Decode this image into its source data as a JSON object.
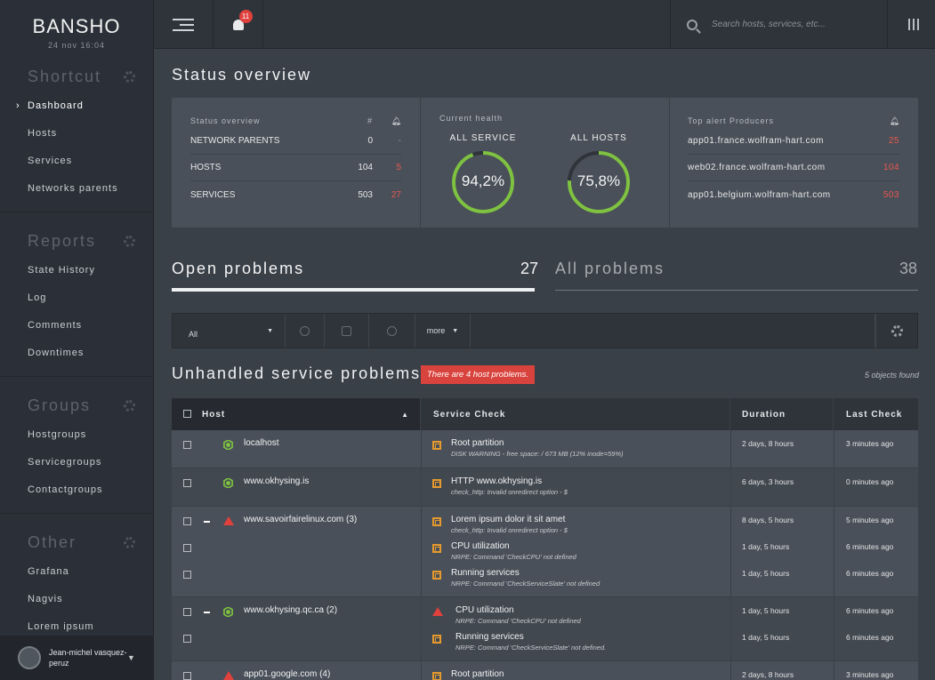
{
  "brand": {
    "name": "BANSHO",
    "date": "24 nov 16:04"
  },
  "sidebar": {
    "sections": [
      {
        "title": "Shortcut",
        "items": [
          {
            "label": "Dashboard",
            "active": true
          },
          {
            "label": "Hosts"
          },
          {
            "label": "Services"
          },
          {
            "label": "Networks parents"
          }
        ]
      },
      {
        "title": "Reports",
        "items": [
          {
            "label": "State History"
          },
          {
            "label": "Log"
          },
          {
            "label": "Comments"
          },
          {
            "label": "Downtimes"
          }
        ]
      },
      {
        "title": "Groups",
        "items": [
          {
            "label": "Hostgroups"
          },
          {
            "label": "Servicegroups"
          },
          {
            "label": "Contactgroups"
          }
        ]
      },
      {
        "title": "Other",
        "items": [
          {
            "label": "Grafana"
          },
          {
            "label": "Nagvis"
          },
          {
            "label": "Lorem ipsum"
          }
        ]
      }
    ],
    "user": {
      "name": "Jean-michel vasquez-peruz"
    }
  },
  "topbar": {
    "notifications": "11",
    "search_placeholder": "Search hosts, services, etc..."
  },
  "page_title": "Status overview",
  "overview": {
    "status": {
      "header": "Status overview",
      "col_count": "#",
      "rows": [
        {
          "label": "NETWORK PARENTS",
          "count": "0",
          "alerts": "-"
        },
        {
          "label": "HOSTS",
          "count": "104",
          "alerts": "5"
        },
        {
          "label": "SERVICES",
          "count": "503",
          "alerts": "27"
        }
      ]
    },
    "health": {
      "header": "Current health",
      "gauges": [
        {
          "label": "ALL SERVICE",
          "value": "94,2%",
          "fraction": 0.942
        },
        {
          "label": "ALL HOSTS",
          "value": "75,8%",
          "fraction": 0.758
        }
      ]
    },
    "producers": {
      "header": "Top alert Producers",
      "rows": [
        {
          "host": "app01.france.wolfram-hart.com",
          "count": "25"
        },
        {
          "host": "web02.france.wolfram-hart.com",
          "count": "104"
        },
        {
          "host": "app01.belgium.wolfram-hart.com",
          "count": "503"
        }
      ]
    }
  },
  "problem_tabs": [
    {
      "label": "Open problems",
      "count": "27",
      "active": true
    },
    {
      "label": "All problems",
      "count": "38",
      "active": false
    }
  ],
  "filter": {
    "select": "All",
    "more": "more"
  },
  "unhandled": {
    "title": "Unhandled service problems",
    "alert": "There are 4 host problems.",
    "found": "5 objects found"
  },
  "table": {
    "headers": {
      "host": "Host",
      "service": "Service Check",
      "duration": "Duration",
      "last": "Last Check"
    },
    "groups": [
      {
        "host": "localhost",
        "icon": "ok",
        "services": [
          {
            "name": "Root partition",
            "detail": "DISK WARNING - free space: / 673 MB (12% inode=59%)",
            "duration": "2 days, 8 hours",
            "last": "3 minutes ago",
            "icon": "warn"
          }
        ]
      },
      {
        "host": "www.okhysing.is",
        "icon": "ok",
        "services": [
          {
            "name": "HTTP www.okhysing.is",
            "detail": "check_http: Invalid onredirect option - $",
            "duration": "6 days, 3 hours",
            "last": "0 minutes ago",
            "icon": "warn"
          }
        ]
      },
      {
        "host": "www.savoirfairelinux.com (3)",
        "icon": "crit",
        "services": [
          {
            "name": "Lorem ipsum dolor it sit amet",
            "detail": "check_http: Invalid onredirect option - $",
            "duration": "8 days, 5 hours",
            "last": "5 minutes ago",
            "icon": "warn"
          },
          {
            "name": "CPU utilization",
            "detail": "NRPE: Command 'CheckCPU' not defined",
            "duration": "1 day, 5 hours",
            "last": "6 minutes ago",
            "icon": "warn"
          },
          {
            "name": "Running services",
            "detail": "NRPE: Command 'CheckServiceSlate' not defined",
            "duration": "1 day, 5 hours",
            "last": "6 minutes ago",
            "icon": "warn"
          }
        ]
      },
      {
        "host": "www.okhysing.qc.ca (2)",
        "icon": "ok",
        "services": [
          {
            "name": "CPU utilization",
            "detail": "NRPE: Command 'CheckCPU' not defined",
            "duration": "1 day, 5 hours",
            "last": "6 minutes ago",
            "icon": "crit"
          },
          {
            "name": "Running services",
            "detail": "NRPE: Command 'CheckServiceSlate' not defined.",
            "duration": "1 day, 5 hours",
            "last": "6 minutes ago",
            "icon": "warn"
          }
        ]
      },
      {
        "host": "app01.google.com (4)",
        "icon": "crit",
        "services": [
          {
            "name": "Root partition",
            "detail": "",
            "duration": "2 days, 8 hours",
            "last": "3 minutes ago",
            "icon": "warn"
          }
        ]
      }
    ]
  },
  "colors": {
    "accent_green": "#7fc242",
    "alert_red": "#e0413c",
    "warn_orange": "#e59a2e"
  }
}
